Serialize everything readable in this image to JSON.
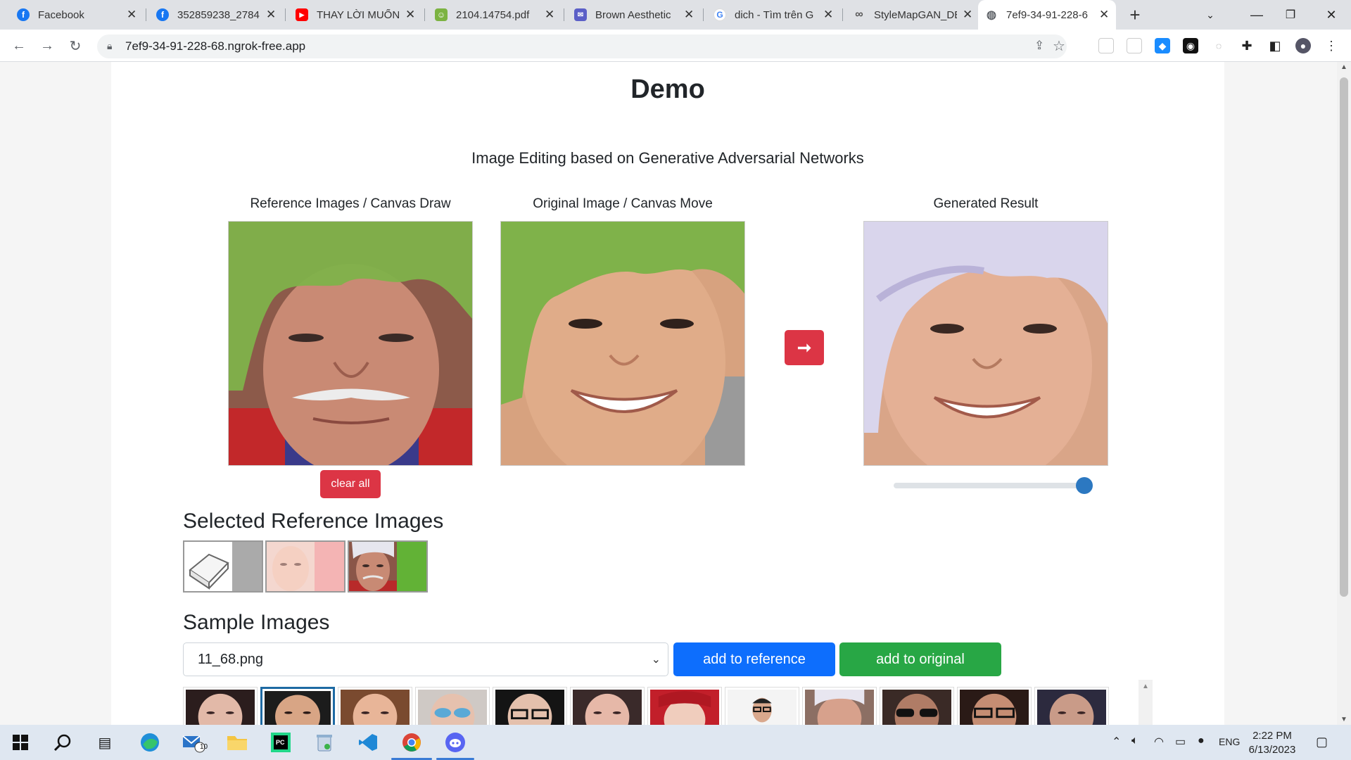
{
  "browser": {
    "tabs": [
      {
        "label": "Facebook",
        "icon": "facebook-icon",
        "color": "#1877f2",
        "glyph": "f"
      },
      {
        "label": "352859238_2784",
        "icon": "facebook-icon",
        "color": "#1877f2",
        "glyph": "f"
      },
      {
        "label": "THAY LỜI MUỐN",
        "icon": "youtube-icon",
        "color": "#ff0000",
        "glyph": "▶"
      },
      {
        "label": "2104.14754.pdf",
        "icon": "pdf-icon",
        "color": "#4caf50",
        "glyph": "☺"
      },
      {
        "label": "Brown Aesthetic",
        "icon": "chat-icon",
        "color": "#5b5fc7",
        "glyph": "✉"
      },
      {
        "label": "dich - Tìm trên G",
        "icon": "google-icon",
        "color": "#ffffff",
        "glyph": "G"
      },
      {
        "label": "StyleMapGAN_DE",
        "icon": "colab-icon",
        "color": "#dfe1e5",
        "glyph": "∞"
      },
      {
        "label": "7ef9-34-91-228-6",
        "icon": "globe-icon",
        "color": "#ffffff",
        "glyph": "◍"
      }
    ],
    "url": "7ef9-34-91-228-68.ngrok-free.app"
  },
  "page": {
    "title": "Demo",
    "subtitle": "Image Editing based on Generative Adversarial Networks",
    "reference_label": "Reference Images / Canvas Draw",
    "original_label": "Original Image / Canvas Move",
    "result_label": "Generated Result",
    "generate_button": "➞",
    "clear_button": "clear all",
    "mix_slider_value": 0.96,
    "selected_ref_heading": "Selected Reference Images",
    "sample_heading": "Sample Images",
    "sample_select_value": "11_68.png",
    "add_reference_button": "add to reference",
    "add_original_button": "add to original"
  },
  "taskbar": {
    "language": "ENG",
    "time": "2:22 PM",
    "date": "6/13/2023",
    "mail_badge": "10"
  }
}
